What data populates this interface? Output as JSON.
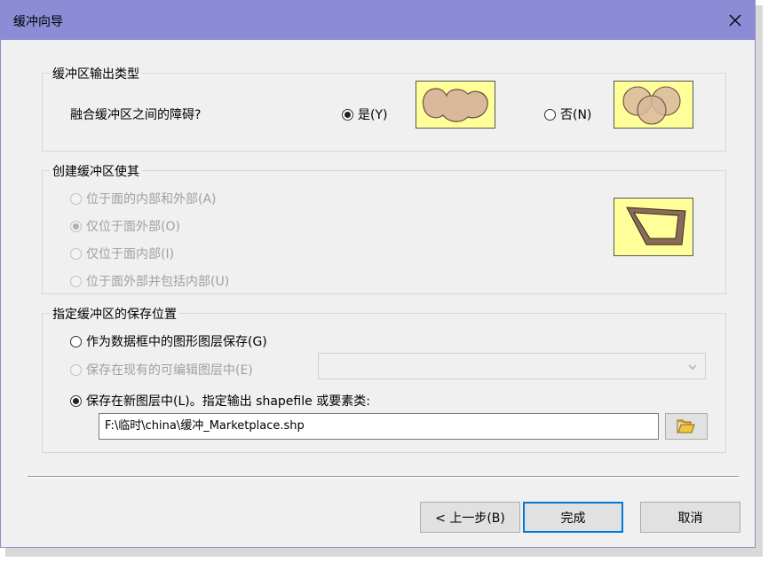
{
  "window": {
    "title": "缓冲向导"
  },
  "group1": {
    "title": "缓冲区输出类型",
    "question": "融合缓冲区之间的障碍?",
    "yes_label": "是(Y)",
    "no_label": "否(N)",
    "selected": "yes"
  },
  "group2": {
    "title": "创建缓冲区使其",
    "options": [
      {
        "label": "位于面的内部和外部(A)",
        "selected": false
      },
      {
        "label": "仅位于面外部(O)",
        "selected": true
      },
      {
        "label": "仅位于面内部(I)",
        "selected": false
      },
      {
        "label": "位于面外部并包括内部(U)",
        "selected": false
      }
    ],
    "enabled": false
  },
  "group3": {
    "title": "指定缓冲区的保存位置",
    "option_graphics": "作为数据框中的图形图层保存(G)",
    "option_existing": "保存在现有的可编辑图层中(E)",
    "option_new": "保存在新图层中(L)。指定输出 shapefile 或要素类:",
    "selected": "new",
    "existing_layer_value": "",
    "output_path": "F:\\临时\\china\\缓冲_Marketplace.shp"
  },
  "footer": {
    "back_label": "< 上一步(B)",
    "finish_label": "完成",
    "cancel_label": "取消"
  },
  "colors": {
    "titlebar": "#8b8bd6",
    "thumbnail_bg": "#ffff99",
    "buffer_fill": "#d9b89c",
    "focus_border": "#0078d7"
  }
}
